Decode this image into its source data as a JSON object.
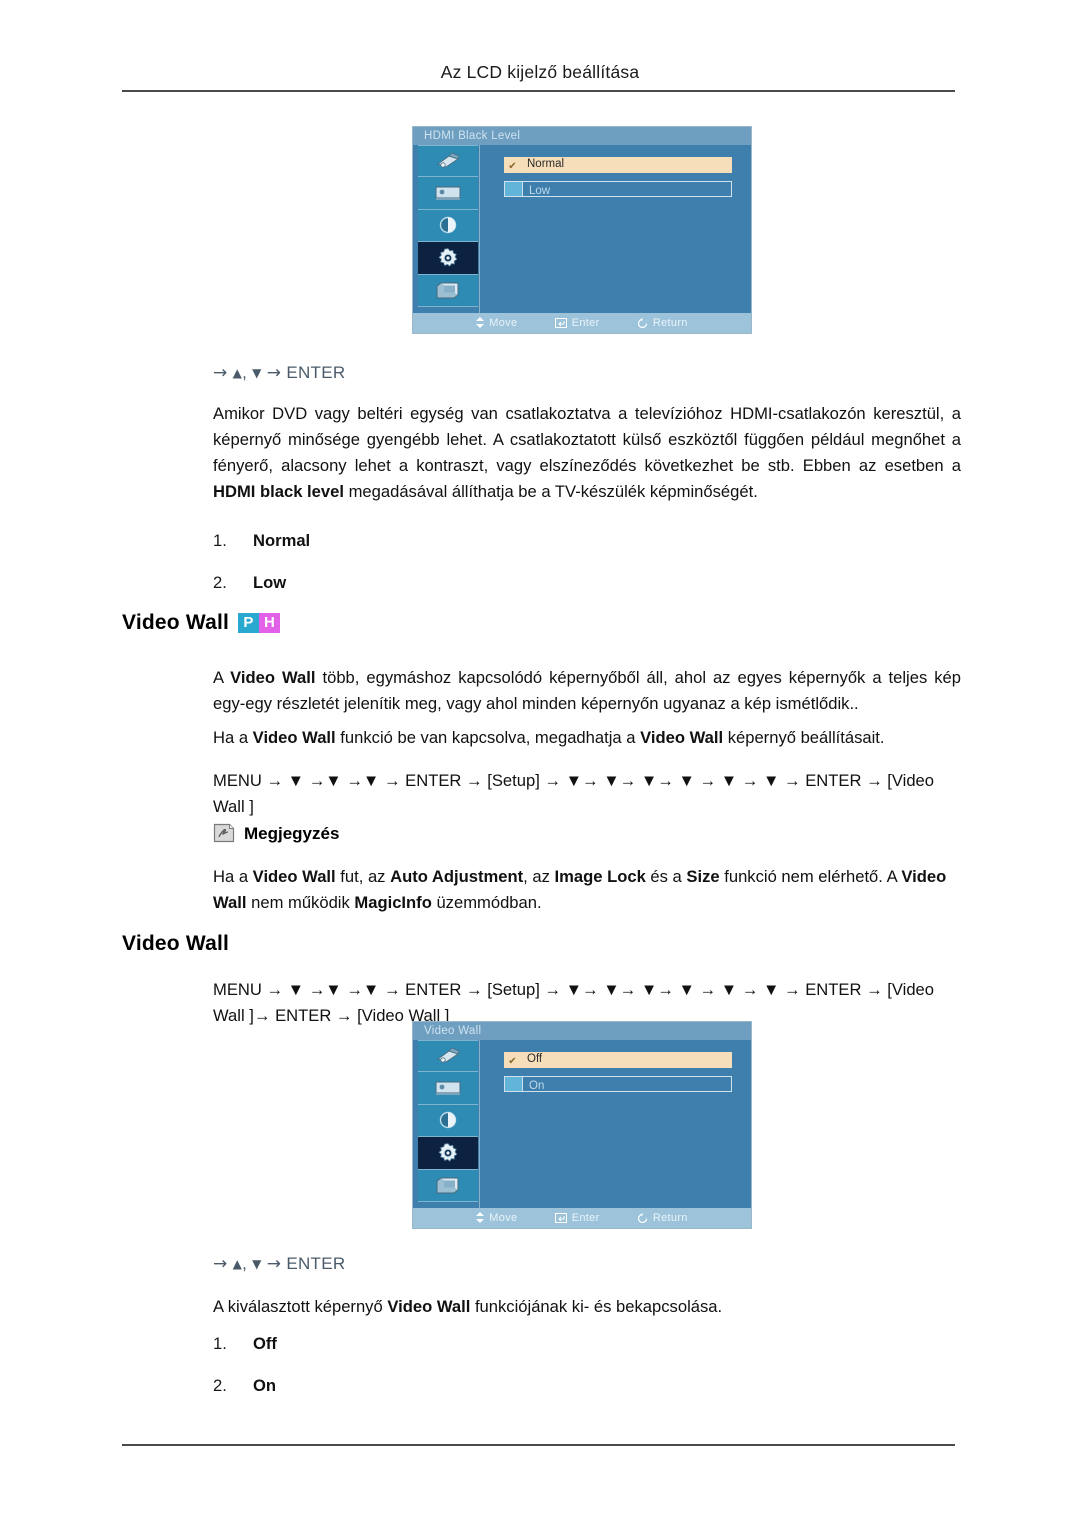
{
  "page": {
    "running_head": "Az LCD kijelző beállítása"
  },
  "osd_hdmi": {
    "title": "HDMI Black Level",
    "options": [
      {
        "label": "Normal",
        "state": "selected"
      },
      {
        "label": "Low",
        "state": "unselected"
      }
    ],
    "statusbar": {
      "move": "Move",
      "enter": "Enter",
      "return": "Return"
    },
    "sidebar_icons": [
      "input-source-icon",
      "picture-icon",
      "sound-icon",
      "setup-gear-icon",
      "multi-control-icon"
    ],
    "active_icon_index": 3
  },
  "hdmi_section": {
    "nav_hint_prefix": "→",
    "nav_hint_up": "▲",
    "nav_hint_comma": ",",
    "nav_hint_down": "▼",
    "nav_hint_arrow2": "→",
    "nav_hint_enter": "ENTER",
    "paragraph_1": "Amikor DVD vagy beltéri egység van csatlakoztatva a televízióhoz HDMI-csatlakozón keresztül, a képernyő minősége gyengébb lehet. A csatlakoztatott külső eszköztől függően például megnőhet a fényerő, alacsony lehet a kontraszt, vagy elszíneződés következhet be stb. Ebben az esetben a ",
    "paragraph_1_bold": "HDMI black level",
    "paragraph_1_tail": " megadásával állíthatja be a TV-készülék képminőségét.",
    "list": [
      {
        "num": "1.",
        "value": "Normal"
      },
      {
        "num": "2.",
        "value": "Low"
      }
    ]
  },
  "videowall_section": {
    "heading": "Video Wall",
    "badges": [
      {
        "letter": "P",
        "color": "#29a8d0"
      },
      {
        "letter": "H",
        "color": "#e361e8"
      }
    ],
    "paragraph_1_a": "A ",
    "paragraph_1_b": "Video Wall",
    "paragraph_1_c": " több, egymáshoz kapcsolódó képernyőből áll, ahol az egyes képernyők a teljes kép egy-egy részletét jelenítik meg, vagy ahol minden képernyőn ugyanaz a kép ismétlődik..",
    "paragraph_2_a": "Ha a ",
    "paragraph_2_b": "Video Wall",
    "paragraph_2_c": " funkció be van kapcsolva, megadhatja a ",
    "paragraph_2_d": "Video Wall",
    "paragraph_2_e": " képernyő beállításait.",
    "menu_path": "MENU → ▼ →▼ →▼ → ENTER → [Setup] → ▼→ ▼→ ▼→ ▼ → ▼ → ▼ → ENTER → [Video Wall ]",
    "note_label": "Megjegyzés",
    "note_icon": "note-hand-icon",
    "note_text_a": "Ha a ",
    "note_text_b": "Video Wall",
    "note_text_c": " fut, az ",
    "note_text_d": "Auto Adjustment",
    "note_text_e": ", az ",
    "note_text_f": "Image Lock",
    "note_text_g": " és a ",
    "note_text_h": "Size",
    "note_text_i": " funkció nem elérhető. A ",
    "note_text_j": "Video Wall",
    "note_text_k": " nem működik ",
    "note_text_l": "MagicInfo",
    "note_text_m": " üzemmódban."
  },
  "videowall_sub": {
    "heading": "Video Wall",
    "menu_path": "MENU → ▼ →▼ →▼ → ENTER → [Setup] → ▼→ ▼→ ▼→ ▼ → ▼ → ▼ → ENTER → [Video Wall ]→ ENTER → [Video Wall ]",
    "nav_hint_enter": "ENTER",
    "description_a": "A kiválasztott képernyő ",
    "description_b": "Video Wall",
    "description_c": " funkciójának ki- és bekapcsolása.",
    "list": [
      {
        "num": "1.",
        "value": "Off"
      },
      {
        "num": "2.",
        "value": "On"
      }
    ]
  },
  "osd_videowall": {
    "title": "Video Wall",
    "options": [
      {
        "label": "Off",
        "state": "selected"
      },
      {
        "label": "On",
        "state": "unselected"
      }
    ],
    "statusbar": {
      "move": "Move",
      "enter": "Enter",
      "return": "Return"
    },
    "sidebar_icons": [
      "input-source-icon",
      "picture-icon",
      "sound-icon",
      "setup-gear-icon",
      "multi-control-icon"
    ],
    "active_icon_index": 3
  }
}
